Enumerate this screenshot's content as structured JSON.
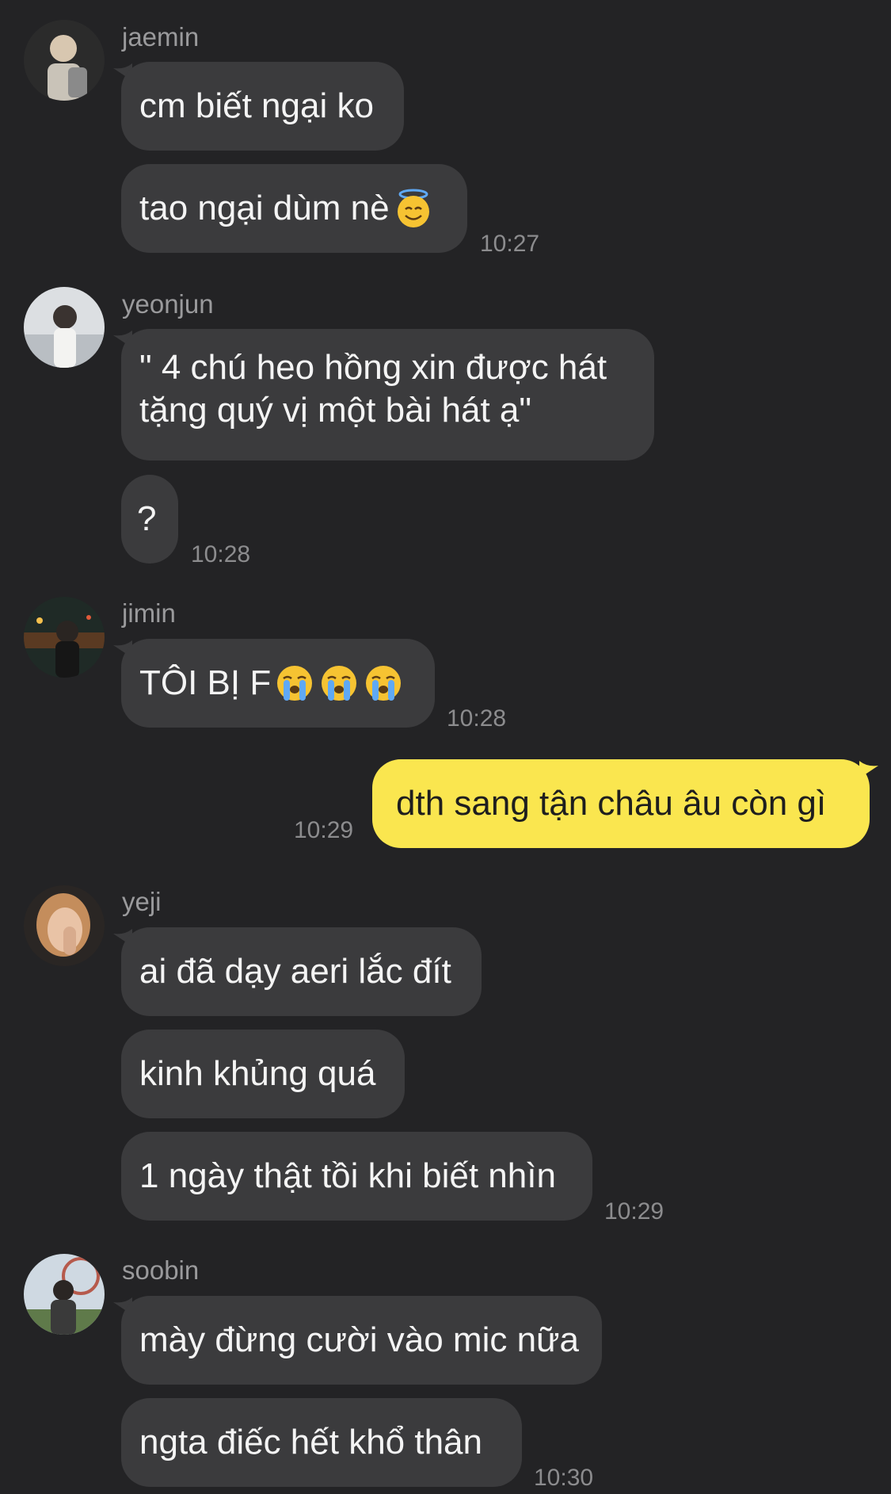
{
  "groups": [
    {
      "sender": "jaemin",
      "messages": [
        "cm biết ngại ko",
        "tao ngại dùm nè"
      ],
      "time": "10:27",
      "emoji": "smiling-face-with-halo-icon"
    },
    {
      "sender": "yeonjun",
      "messages": [
        "\" 4 chú heo hồng xin được hát tặng quý vị một bài hát ạ\"",
        "?"
      ],
      "time": "10:28"
    },
    {
      "sender": "jimin",
      "messages": [
        "TÔI BỊ F"
      ],
      "time": "10:28",
      "emoji": "loudly-crying-face-icon"
    },
    {
      "sender": "me",
      "messages": [
        "dth sang tận châu âu còn gì"
      ],
      "time": "10:29"
    },
    {
      "sender": "yeji",
      "messages": [
        "ai đã dạy aeri lắc đít",
        "kinh khủng quá",
        "1 ngày thật tồi khi biết nhìn"
      ],
      "time": "10:29"
    },
    {
      "sender": "soobin",
      "messages": [
        "mày đừng cười vào mic nữa",
        "ngta điếc hết khổ thân"
      ],
      "time": "10:30"
    }
  ],
  "colors": {
    "background": "#232325",
    "incoming_bubble": "#3b3b3d",
    "outgoing_bubble": "#fae64f",
    "sender_text": "#9a9a9c",
    "timestamp_text": "#8c8c8e"
  }
}
